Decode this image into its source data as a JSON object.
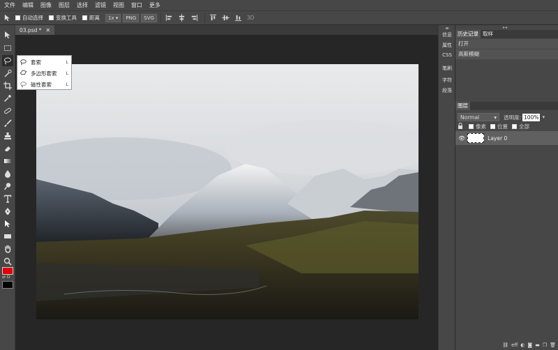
{
  "menu": [
    "文件",
    "编辑",
    "图像",
    "图层",
    "选择",
    "滤镜",
    "视图",
    "窗口",
    "更多"
  ],
  "options": {
    "auto_select": "自动选择",
    "transform_tools": "变换工具",
    "distance": "距离",
    "zoom": "1x",
    "png": "PNG",
    "svg": "SVG",
    "three_d": "3D"
  },
  "document": {
    "tab_title": "03.psd *",
    "close": "✕"
  },
  "lasso_flyout": [
    {
      "label": "套索",
      "key": "L"
    },
    {
      "label": "多边形套索",
      "key": "L"
    },
    {
      "label": "磁性套索",
      "key": "L"
    }
  ],
  "side_tabs": [
    "信息",
    "属性",
    "CSS",
    "笔刷",
    "字符",
    "段落"
  ],
  "history_panel": {
    "tabs": [
      "历史记录",
      "取样"
    ],
    "items": [
      "打开",
      "高斯模糊"
    ]
  },
  "layers_panel": {
    "tab": "图层",
    "blend_mode": "Normal",
    "opacity_label": "透明度:",
    "opacity_value": "100%",
    "lock_options": [
      "像素",
      "位置",
      "全部"
    ],
    "layers": [
      {
        "name": "Layer 0"
      }
    ]
  },
  "bottom_icons": [
    "eff"
  ],
  "colors": {
    "foreground": "#e00000",
    "background": "#000000"
  }
}
